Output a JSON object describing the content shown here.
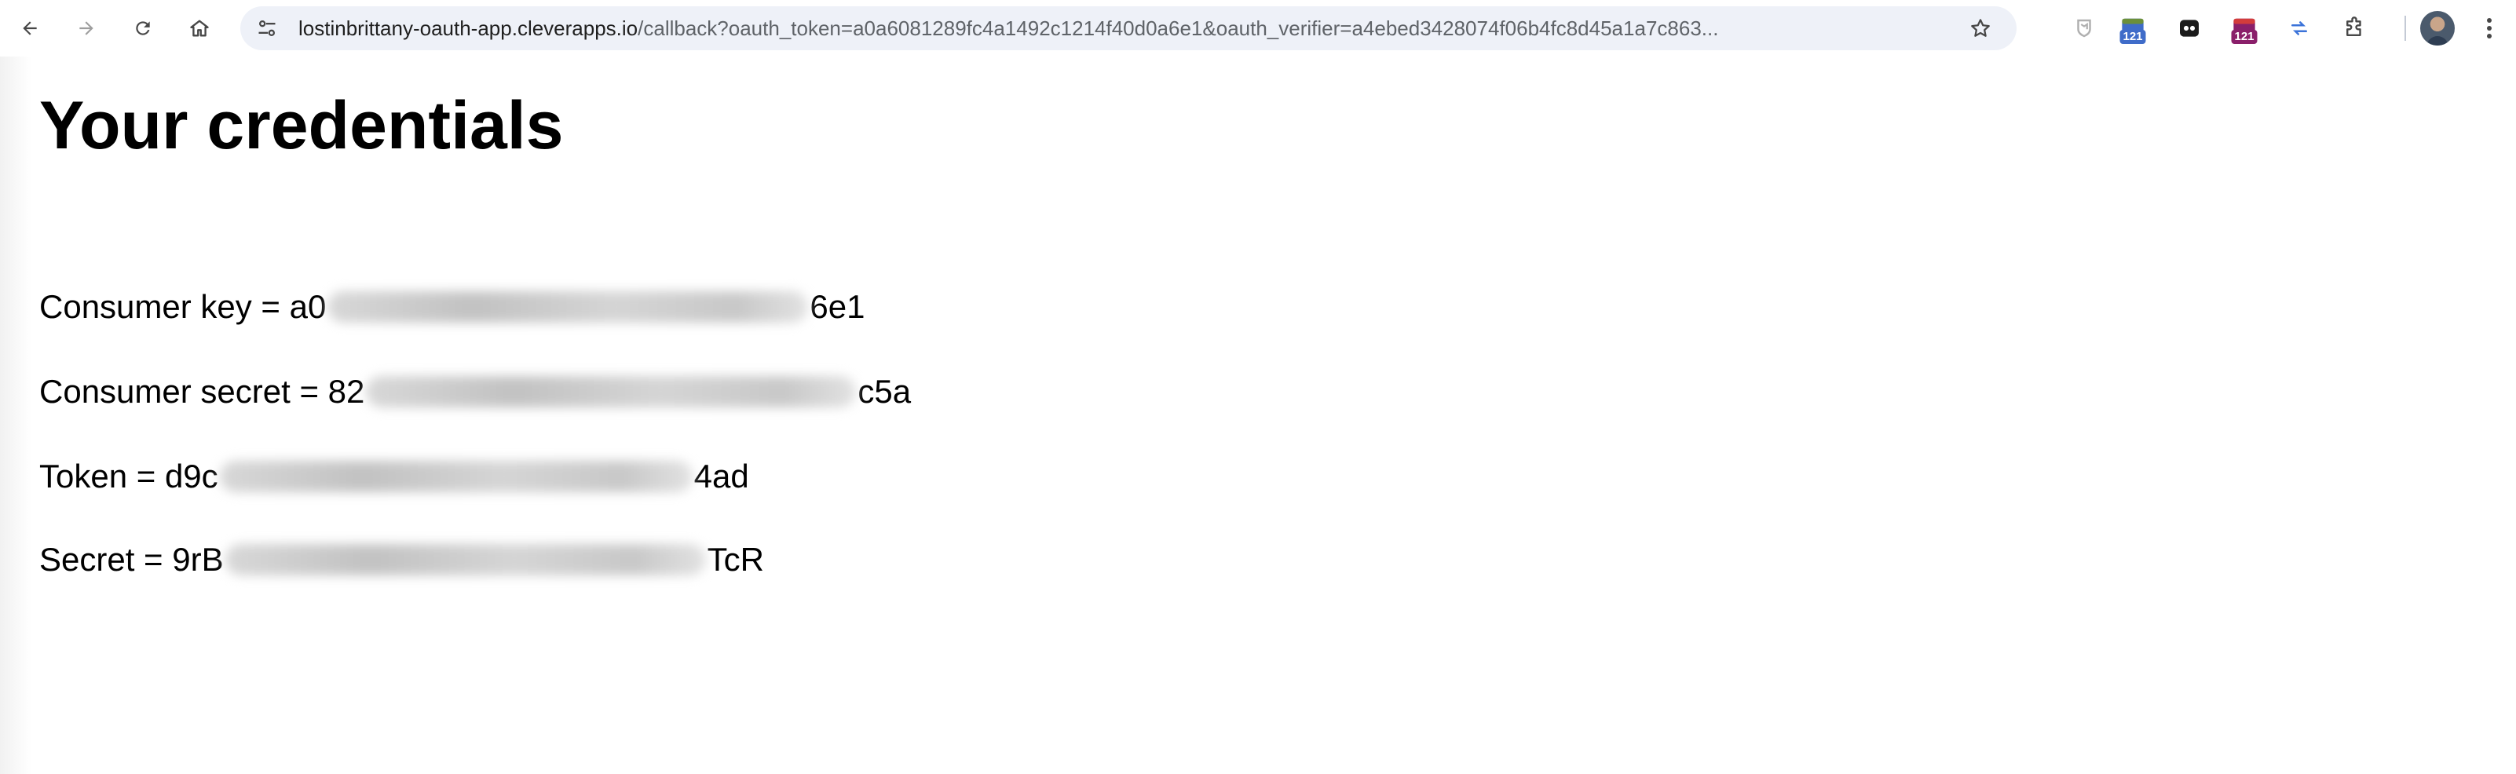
{
  "browser": {
    "url_host": "lostinbrittany-oauth-app.cleverapps.io",
    "url_path": "/callback?oauth_token=a0a6081289fc4a1492c1214f40d0a6e1&oauth_verifier=a4ebed3428074f06b4fc8d45a1a7c863...",
    "extensions": [
      {
        "icon": "shield-icon"
      },
      {
        "icon": "calendar-icon",
        "badge": "121",
        "color": "#3f6cc9"
      },
      {
        "icon": "mask-icon"
      },
      {
        "icon": "calendar-icon",
        "badge": "121",
        "color": "#8a1f6a"
      },
      {
        "icon": "sync-icon"
      },
      {
        "icon": "puzzle-icon"
      }
    ]
  },
  "page": {
    "heading": "Your credentials",
    "credentials": [
      {
        "label": "Consumer key = ",
        "prefix": "a0",
        "suffix": "6e1"
      },
      {
        "label": "Consumer secret = ",
        "prefix": "82",
        "suffix": "c5a"
      },
      {
        "label": "Token = ",
        "prefix": "d9c",
        "suffix": "4ad"
      },
      {
        "label": "Secret = ",
        "prefix": "9rB",
        "suffix": "TcR"
      }
    ]
  }
}
